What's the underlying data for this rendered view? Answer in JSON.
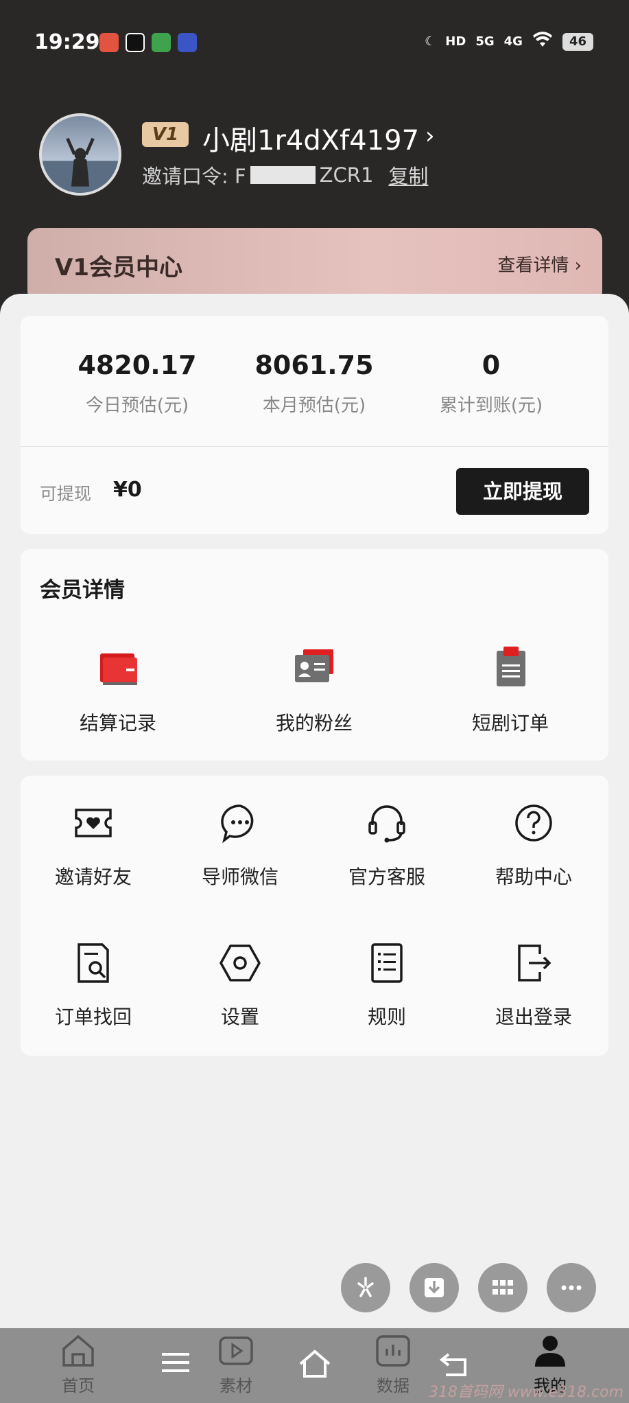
{
  "status_bar": {
    "time": "19:29",
    "network_1": "5G",
    "network_2": "4G",
    "hd": "HD",
    "battery": "46"
  },
  "profile": {
    "level": "V1",
    "username": "小剧1r4dXf4197",
    "invite_label": "邀请口令: F",
    "invite_suffix": "ZCR1",
    "copy_label": "复制"
  },
  "vip_banner": {
    "title": "V1会员中心",
    "more": "查看详情"
  },
  "earnings": {
    "today_value": "4820.17",
    "today_label": "今日预估(元)",
    "month_value": "8061.75",
    "month_label": "本月预估(元)",
    "total_value": "0",
    "total_label": "累计到账(元)",
    "withdrawable_label": "可提现",
    "withdrawable_amount": "¥0",
    "withdraw_button": "立即提现"
  },
  "member": {
    "title": "会员详情",
    "items": [
      {
        "label": "结算记录",
        "icon": "wallet-icon"
      },
      {
        "label": "我的粉丝",
        "icon": "id-card-icon"
      },
      {
        "label": "短剧订单",
        "icon": "clipboard-icon"
      }
    ]
  },
  "tools": {
    "items": [
      {
        "label": "邀请好友",
        "icon": "ticket-heart-icon"
      },
      {
        "label": "导师微信",
        "icon": "chat-icon"
      },
      {
        "label": "官方客服",
        "icon": "headset-icon"
      },
      {
        "label": "帮助中心",
        "icon": "help-icon"
      },
      {
        "label": "订单找回",
        "icon": "document-search-icon"
      },
      {
        "label": "设置",
        "icon": "settings-icon"
      },
      {
        "label": "规则",
        "icon": "list-icon"
      },
      {
        "label": "退出登录",
        "icon": "logout-icon"
      }
    ]
  },
  "tab_bar": {
    "items": [
      {
        "label": "首页",
        "icon": "home-icon"
      },
      {
        "label": "素材",
        "icon": "play-icon"
      },
      {
        "label": "数据",
        "icon": "chart-icon"
      },
      {
        "label": "我的",
        "icon": "user-icon"
      }
    ]
  },
  "watermark": "318首码网 www.e318.com"
}
